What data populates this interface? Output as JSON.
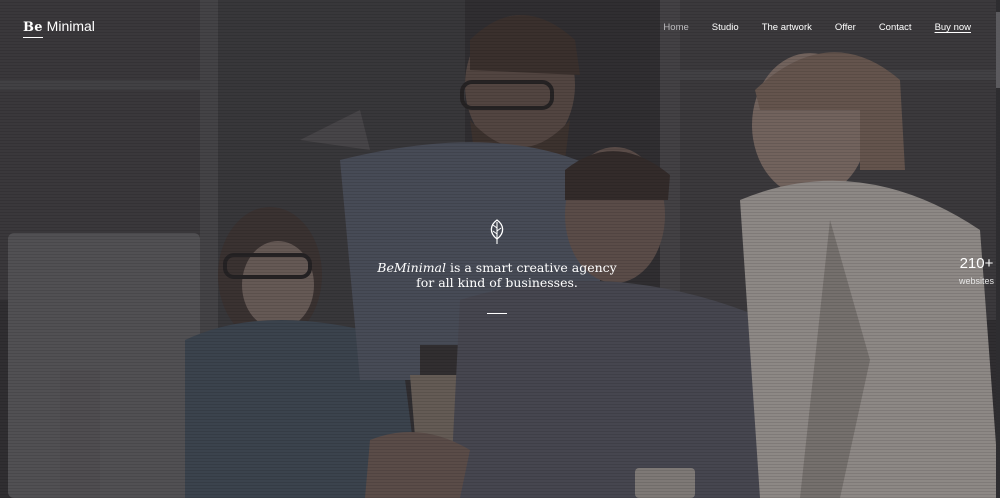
{
  "brand": {
    "mark": "Be",
    "name": "Minimal"
  },
  "nav": {
    "items": [
      {
        "label": "Home",
        "active": true
      },
      {
        "label": "Studio"
      },
      {
        "label": "The artwork"
      },
      {
        "label": "Offer"
      },
      {
        "label": "Contact"
      },
      {
        "label": "Buy now",
        "cta": true
      }
    ]
  },
  "hero": {
    "brand_italic": "BeMinimal",
    "line1": " is a smart creative agency",
    "line2": "for all kind of businesses.",
    "icon": "leaf-icon"
  },
  "counter": {
    "value": "210+",
    "label": "websites"
  },
  "colors": {
    "overlay": "#1c1b1e",
    "text": "#ffffff",
    "nav_active": "#bdbcbf"
  }
}
